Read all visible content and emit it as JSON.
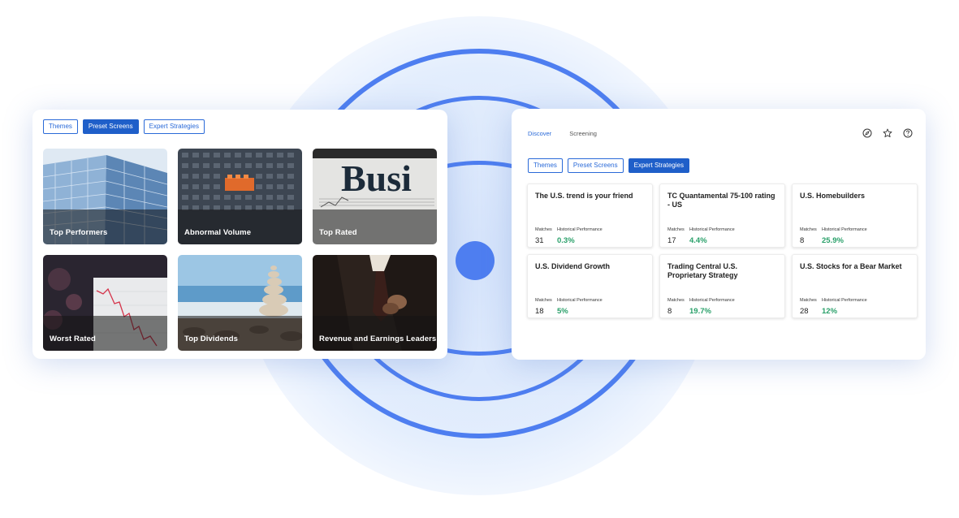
{
  "colors": {
    "accent": "#1f5fc9",
    "ring": "#4e7ef0",
    "positive": "#2aa06a"
  },
  "preset_panel": {
    "tabs": [
      {
        "label": "Themes",
        "active": false
      },
      {
        "label": "Preset Screens",
        "active": true
      },
      {
        "label": "Expert Strategies",
        "active": false
      }
    ],
    "tiles": [
      {
        "label": "Top Performers",
        "image": "glass-skyscraper"
      },
      {
        "label": "Abnormal Volume",
        "image": "building-blocks"
      },
      {
        "label": "Top Rated",
        "image": "business-newspaper"
      },
      {
        "label": "Worst Rated",
        "image": "falling-chart-screen"
      },
      {
        "label": "Top Dividends",
        "image": "stacked-stones-beach"
      },
      {
        "label": "Revenue and Earnings Leaders",
        "image": "businessman-tie"
      }
    ]
  },
  "expert_panel": {
    "nav": [
      {
        "label": "Discover",
        "active": true
      },
      {
        "label": "Screening",
        "active": false
      }
    ],
    "icons": [
      "compass-icon",
      "star-icon",
      "help-icon"
    ],
    "tabs": [
      {
        "label": "Themes",
        "active": false
      },
      {
        "label": "Preset Screens",
        "active": false
      },
      {
        "label": "Expert Strategies",
        "active": true
      }
    ],
    "matches_label": "Matches",
    "performance_label": "Historical Performance",
    "strategies": [
      {
        "title": "The U.S. trend is your friend",
        "matches": "31",
        "performance": "0.3%"
      },
      {
        "title": "TC Quantamental 75-100 rating - US",
        "matches": "17",
        "performance": "4.4%"
      },
      {
        "title": "U.S. Homebuilders",
        "matches": "8",
        "performance": "25.9%"
      },
      {
        "title": "U.S. Dividend Growth",
        "matches": "18",
        "performance": "5%"
      },
      {
        "title": "Trading Central U.S. Proprietary Strategy",
        "matches": "8",
        "performance": "19.7%"
      },
      {
        "title": "U.S. Stocks for a Bear Market",
        "matches": "28",
        "performance": "12%"
      }
    ]
  }
}
